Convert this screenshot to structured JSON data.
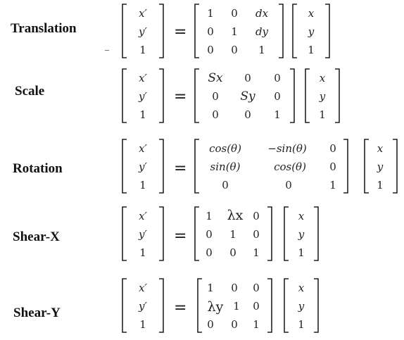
{
  "transforms": [
    {
      "label": "Translation",
      "lhs": [
        "x′",
        "y′",
        "1"
      ],
      "matrix": [
        [
          "1",
          "0",
          "dx"
        ],
        [
          "0",
          "1",
          "dy"
        ],
        [
          "0",
          "0",
          "1"
        ]
      ],
      "vector": [
        "x",
        "y",
        "1"
      ]
    },
    {
      "label": "Scale",
      "lhs": [
        "x′",
        "y′",
        "1"
      ],
      "matrix": [
        [
          "Sx",
          "0",
          "0"
        ],
        [
          "0",
          "Sy",
          "0"
        ],
        [
          "0",
          "0",
          "1"
        ]
      ],
      "vector": [
        "x",
        "y",
        "1"
      ]
    },
    {
      "label": "Rotation",
      "lhs": [
        "x′",
        "y′",
        "1"
      ],
      "matrix": [
        [
          "cos(θ)",
          "−sin(θ)",
          "0"
        ],
        [
          "sin(θ)",
          "cos(θ)",
          "0"
        ],
        [
          "0",
          "0",
          "1"
        ]
      ],
      "vector": [
        "x",
        "y",
        "1"
      ]
    },
    {
      "label": "Shear-X",
      "lhs": [
        "x′",
        "y′",
        "1"
      ],
      "matrix": [
        [
          "1",
          "λx",
          "0"
        ],
        [
          "0",
          "1",
          "0"
        ],
        [
          "0",
          "0",
          "1"
        ]
      ],
      "vector": [
        "x",
        "y",
        "1"
      ]
    },
    {
      "label": "Shear-Y",
      "lhs": [
        "x′",
        "y′",
        "1"
      ],
      "matrix": [
        [
          "1",
          "0",
          "0"
        ],
        [
          "λy",
          "1",
          "0"
        ],
        [
          "0",
          "0",
          "1"
        ]
      ],
      "vector": [
        "x",
        "y",
        "1"
      ]
    }
  ]
}
